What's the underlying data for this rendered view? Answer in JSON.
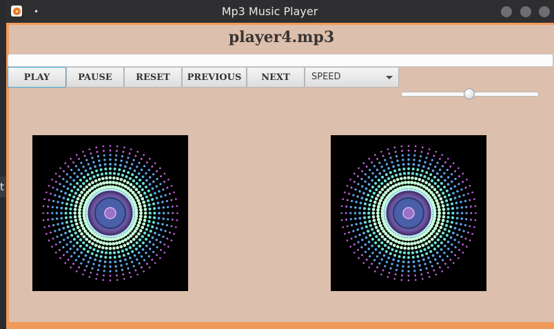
{
  "desktop": {
    "fragment_text": "t"
  },
  "window": {
    "title": "Mp3 Music Player",
    "menu_glyph": "•",
    "app_icon": "music-player-icon",
    "controls": [
      "minimize-icon",
      "maximize-icon",
      "close-icon"
    ]
  },
  "player": {
    "now_playing": "player4.mp3",
    "playback_progress": 0,
    "buttons": {
      "play": "PLAY",
      "pause": "PAUSE",
      "reset": "RESET",
      "previous": "PREVIOUS",
      "next": "NEXT"
    },
    "speed": {
      "selected": "SPEED"
    },
    "volume": {
      "level": 0.5
    },
    "artwork": [
      "speaker-light-art",
      "speaker-light-art"
    ]
  },
  "colors": {
    "frame": "#f09a5a",
    "panel": "#dcbfac",
    "titlebar": "#2e2e31",
    "focus": "#3fa9d8"
  }
}
